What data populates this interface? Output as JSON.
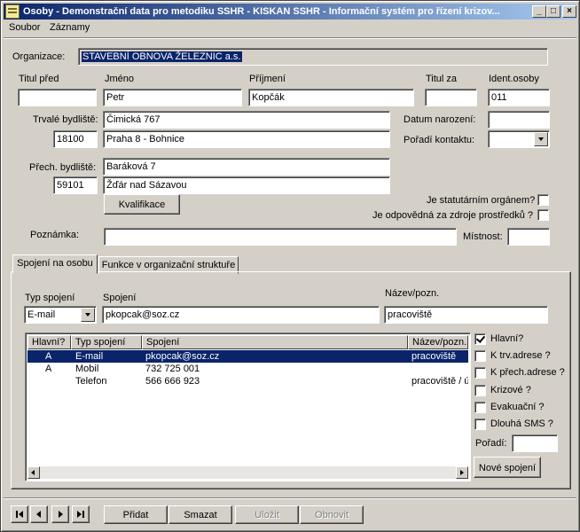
{
  "window": {
    "title": "Osoby - Demonstrační data pro metodiku SSHR - KISKAN SSHR - Informační systém pro řízení krizov...",
    "minimize": "_",
    "maximize": "□",
    "close": "×"
  },
  "menu": [
    {
      "label": "Soubor"
    },
    {
      "label": "Záznamy"
    }
  ],
  "organizace": {
    "label": "Organizace:",
    "value": "STAVEBNÍ OBNOVA ŽELEZNIC a.s."
  },
  "person": {
    "titul_pred_label": "Titul před",
    "titul_pred": "",
    "jmeno_label": "Jméno",
    "jmeno": "Petr",
    "prijmeni_label": "Příjmení",
    "prijmeni": "Kopčák",
    "titul_za_label": "Titul za",
    "titul_za": "",
    "ident_label": "Ident.osoby",
    "ident": "011"
  },
  "address": {
    "trvale_label": "Trvalé bydliště:",
    "trvale_ulice": "Čimická 767",
    "trvale_psc": "18100",
    "trvale_mesto": "Praha 8 - Bohnice",
    "prech_label": "Přech. bydliště:",
    "prech_ulice": "Baráková 7",
    "prech_psc": "59101",
    "prech_mesto": "Žďár nad Sázavou",
    "datum_label": "Datum narození:",
    "datum": "",
    "poradi_label": "Pořadí kontaktu:",
    "poradi": ""
  },
  "kvalifikace": "Kvalifikace",
  "statutarni_label": "Je statutárním orgánem?",
  "zdroje_label": "Je odpovědná za zdroje prostředků ?",
  "poznamka_label": "Poznámka:",
  "poznamka": "",
  "mistnost_label": "Místnost:",
  "mistnost": "",
  "tabs": [
    "Spojení na osobu",
    "Funkce v organizační struktuře"
  ],
  "spojeni_form": {
    "typ_label": "Typ spojení",
    "typ": "E-mail",
    "spojeni_label": "Spojení",
    "spojeni": "pkopcak@soz.cz",
    "nazev_label": "Název/pozn.",
    "nazev": "pracoviště"
  },
  "grid": {
    "columns": [
      "Hlavní?",
      "Typ spojení",
      "Spojení",
      "Název/pozn."
    ],
    "rows": [
      {
        "hlavni": "A",
        "typ": "E-mail",
        "spojeni": "pkopcak@soz.cz",
        "nazev": "pracoviště"
      },
      {
        "hlavni": "A",
        "typ": "Mobil",
        "spojeni": "732 725 001",
        "nazev": ""
      },
      {
        "hlavni": "",
        "typ": "Telefon",
        "spojeni": "566 666 923",
        "nazev": "pracoviště / ú"
      }
    ]
  },
  "checks": [
    {
      "label": "Hlavní?",
      "checked": true
    },
    {
      "label": "K trv.adrese ?",
      "checked": false
    },
    {
      "label": "K přech.adrese ?",
      "checked": false
    },
    {
      "label": "Krizové ?",
      "checked": false
    },
    {
      "label": "Evakuační ?",
      "checked": false
    },
    {
      "label": "Dlouhá SMS ?",
      "checked": false
    }
  ],
  "poradi_label": "Pořadí:",
  "poradi": "",
  "nove_spojeni": "Nové spojení",
  "toolbar": {
    "pridat": "Přidat",
    "smazat": "Smazat",
    "ulozit": "Uložit",
    "obnovit": "Obnovit"
  }
}
